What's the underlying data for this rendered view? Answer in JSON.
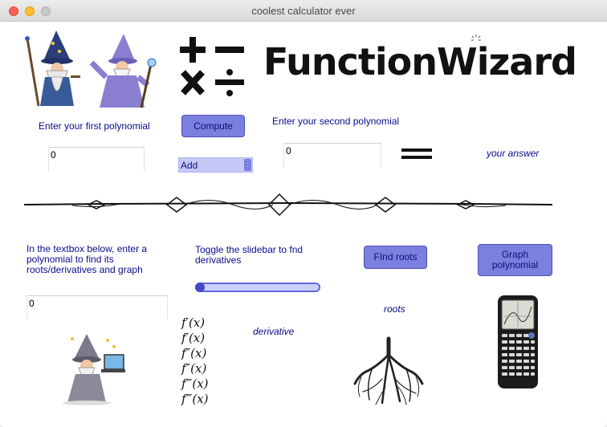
{
  "window": {
    "title": "coolest calculator ever"
  },
  "logo": {
    "text": "FunctionWizard"
  },
  "first_poly": {
    "label": "Enter your first polynomial",
    "value": "0"
  },
  "second_poly": {
    "label": "Enter your second polynomial",
    "value": "0"
  },
  "compute_button": {
    "label": "Compute"
  },
  "operation_select": {
    "selected": "Add",
    "arrow": ":"
  },
  "answer": {
    "text": "your answer"
  },
  "third_poly": {
    "label": "In the textbox below, enter a polynomial to find its roots/derivatives and graph",
    "value": "0"
  },
  "slider": {
    "label": "Toggle the slidebar to fnd derivatives",
    "value": 0
  },
  "find_roots_button": {
    "label": "FInd roots"
  },
  "graph_button": {
    "label": "Graph polynomial"
  },
  "roots_label": {
    "text": "roots"
  },
  "derivative_label": {
    "text": "derivative"
  },
  "derivatives": [
    "f′(x)",
    "f′(x)",
    "f″(x)",
    "f″(x)",
    "f‴(x)",
    "f‴(x)"
  ],
  "icons": [
    "wizard-icon",
    "wizard-icon",
    "math-operators-icon",
    "equals-icon",
    "ornamental-divider",
    "wizard-laptop-icon",
    "roots-icon",
    "calculator-icon"
  ],
  "colors": {
    "button": "#7b7fdd",
    "text": "#0a0a8c"
  }
}
